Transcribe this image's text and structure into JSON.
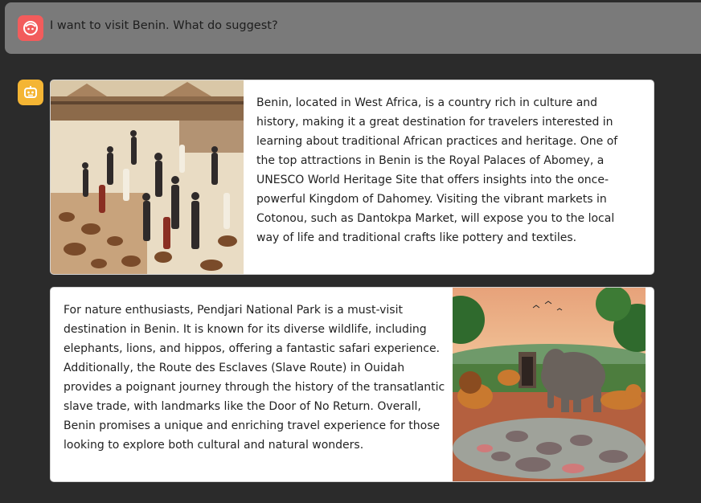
{
  "user_message": {
    "text": "I want to visit Benin. What do suggest?",
    "avatar_icon": "user-face-icon",
    "avatar_color": "#f25c5c"
  },
  "assistant": {
    "avatar_icon": "robot-icon",
    "avatar_color": "#f4b534",
    "cards": [
      {
        "text": "Benin, located in West Africa, is a country rich in culture and history, making it a great destination for travelers interested in learning about traditional African practices and heritage. One of the top attractions in Benin is the Royal Palaces of Abomey, a UNESCO World Heritage Site that offers insights into the once-powerful Kingdom of Dahomey. Visiting the vibrant markets in Cotonou, such as Dantokpa Market, will expose you to the local way of life and traditional crafts like pottery and textiles.",
        "image": "market-illustration"
      },
      {
        "text": "For nature enthusiasts, Pendjari National Park is a must-visit destination in Benin. It is known for its diverse wildlife, including elephants, lions, and hippos, offering a fantastic safari experience. Additionally, the Route des Esclaves (Slave Route) in Ouidah provides a poignant journey through the history of the transatlantic slave trade, with landmarks like the Door of No Return. Overall, Benin promises a unique and enriching travel experience for those looking to explore both cultural and natural wonders.",
        "image": "wildlife-illustration"
      }
    ]
  }
}
